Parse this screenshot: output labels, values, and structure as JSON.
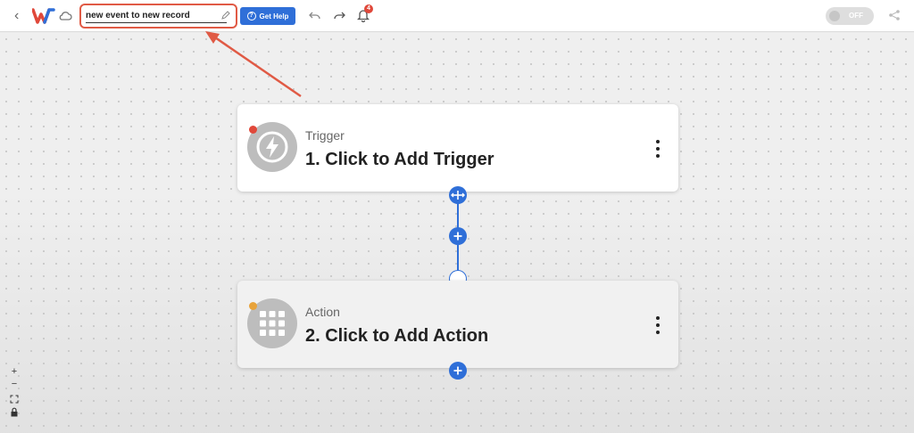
{
  "topbar": {
    "workflow_name": "new event to new record",
    "help_label": "Get Help",
    "notification_count": "4",
    "toggle_label": "OFF"
  },
  "nodes": {
    "trigger": {
      "type_label": "Trigger",
      "title": "1. Click to Add Trigger",
      "status_color": "#e0483a",
      "icon": "lightning-icon"
    },
    "action": {
      "type_label": "Action",
      "title": "2. Click to Add Action",
      "status_color": "#e8a33a",
      "icon": "app-grid-icon"
    }
  },
  "canvas_controls": {
    "zoom_in": "+",
    "zoom_out": "−"
  },
  "colors": {
    "accent": "#2f6fd8",
    "annotation_red": "#e05a45"
  }
}
